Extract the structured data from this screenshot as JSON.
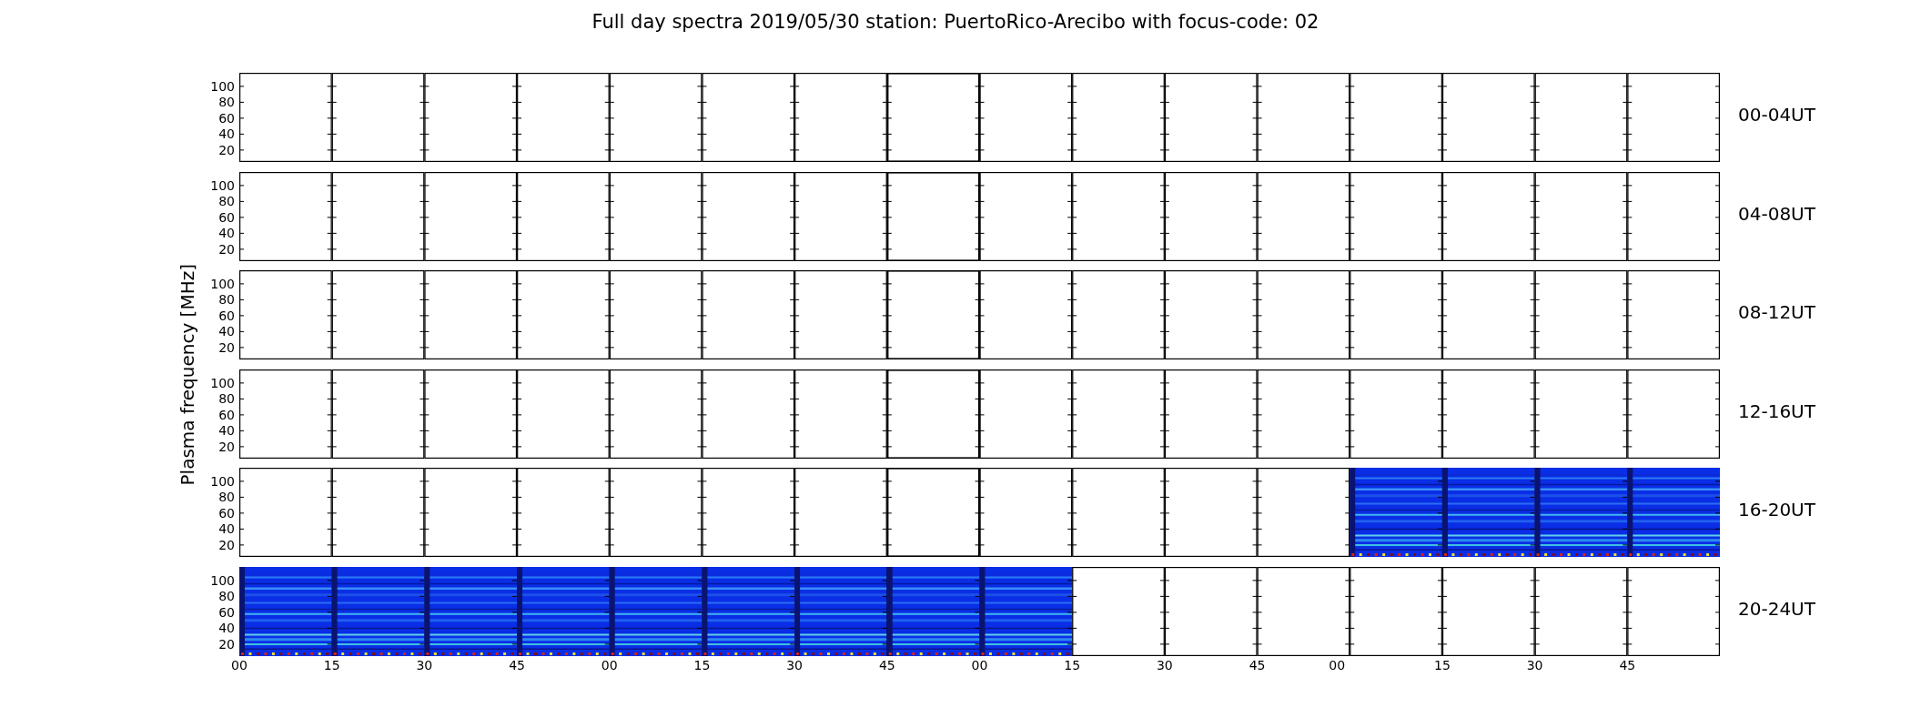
{
  "title": "Full day spectra 2019/05/30 station: PuertoRico-Arecibo with focus-code: 02",
  "ylabel": "Plasma frequency [MHz]",
  "panels": [
    {
      "label": "00-04UT",
      "yticks": [
        "100",
        "80",
        "60",
        "40",
        "20"
      ],
      "spectrum": [
        false,
        false,
        false,
        false,
        false,
        false,
        false,
        false,
        false,
        false,
        false,
        false,
        false,
        false,
        false,
        false
      ]
    },
    {
      "label": "04-08UT",
      "yticks": [
        "100",
        "80",
        "60",
        "40",
        "20"
      ],
      "spectrum": [
        false,
        false,
        false,
        false,
        false,
        false,
        false,
        false,
        false,
        false,
        false,
        false,
        false,
        false,
        false,
        false
      ]
    },
    {
      "label": "08-12UT",
      "yticks": [
        "100",
        "80",
        "60",
        "40",
        "20"
      ],
      "spectrum": [
        false,
        false,
        false,
        false,
        false,
        false,
        false,
        false,
        false,
        false,
        false,
        false,
        false,
        false,
        false,
        false
      ]
    },
    {
      "label": "12-16UT",
      "yticks": [
        "100",
        "80",
        "60",
        "40",
        "20"
      ],
      "spectrum": [
        false,
        false,
        false,
        false,
        false,
        false,
        false,
        false,
        false,
        false,
        false,
        false,
        false,
        false,
        false,
        false
      ]
    },
    {
      "label": "16-20UT",
      "yticks": [
        "100",
        "80",
        "60",
        "40",
        "20"
      ],
      "spectrum": [
        false,
        false,
        false,
        false,
        false,
        false,
        false,
        false,
        false,
        false,
        false,
        false,
        true,
        true,
        true,
        true
      ]
    },
    {
      "label": "20-24UT",
      "yticks": [
        "100",
        "80",
        "60",
        "40",
        "20"
      ],
      "spectrum": [
        true,
        true,
        true,
        true,
        true,
        true,
        true,
        true,
        true,
        false,
        false,
        false,
        false,
        false,
        false,
        false
      ]
    }
  ],
  "xticks": [
    "00",
    "15",
    "30",
    "45",
    "00",
    "15",
    "30",
    "45",
    "00",
    "15",
    "30",
    "45",
    "00",
    "15",
    "30",
    "45"
  ]
}
